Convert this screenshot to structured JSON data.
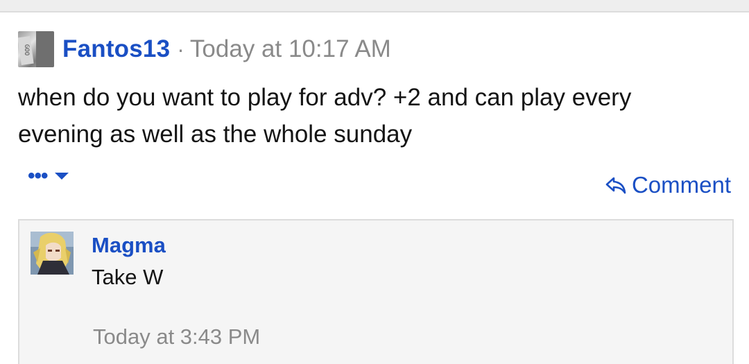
{
  "post": {
    "author": "Fantos13",
    "separator": "·",
    "timestamp": "Today at 10:17 AM",
    "message": "when do you want to play for adv? +2 and can play every evening as well as the whole sunday",
    "avatar_icon": "user-avatar-photo"
  },
  "actions": {
    "more_label": "•••",
    "more_icon": "caret-down-icon",
    "comment_label": "Comment",
    "comment_icon": "reply-arrow-icon"
  },
  "comment": {
    "author": "Magma",
    "text": "Take W",
    "timestamp": "Today at 3:43 PM",
    "avatar_icon": "anime-character-avatar"
  },
  "colors": {
    "link_blue": "#1a4fc4",
    "meta_gray": "#8a8a8a",
    "comment_bg": "#f5f5f5",
    "border": "#dcdcdc"
  }
}
